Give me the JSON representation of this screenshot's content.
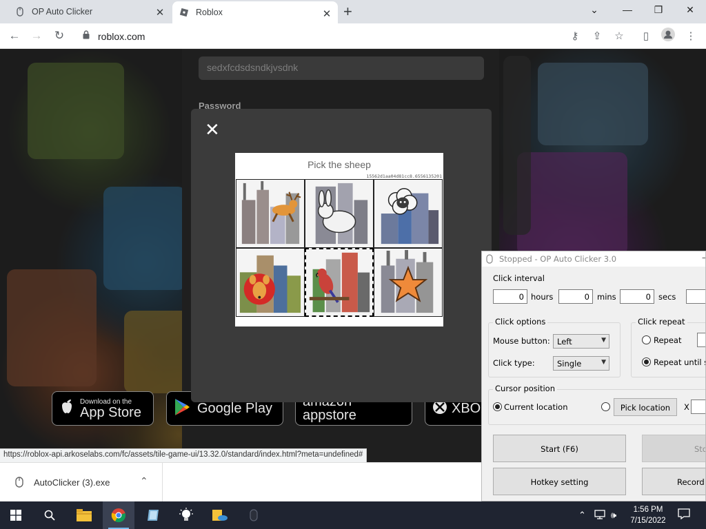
{
  "browser": {
    "tabs": [
      {
        "title": "OP Auto Clicker",
        "icon": "mouse-icon"
      },
      {
        "title": "Roblox",
        "icon": "roblox-icon"
      }
    ],
    "url": "roblox.com",
    "status_url": "https://roblox-api.arkoselabs.com/fc/assets/tile-game-ui/13.32.0/standard/index.html?meta=undefined#"
  },
  "page": {
    "username_value": "sedxfcdsdsndkjvsdnk",
    "password_label": "Password",
    "store_badges": [
      {
        "small": "Download on the",
        "big": "App Store"
      },
      {
        "small": "",
        "big": "Google Play"
      },
      {
        "small": "",
        "big": "amazon appstore"
      },
      {
        "small": "",
        "big": "XBOX"
      }
    ]
  },
  "captcha": {
    "prompt": "Pick the sheep",
    "hash": "15562d1aa04d81cc8.6556135201",
    "tiles": [
      "deer",
      "rabbit",
      "sheep",
      "kangaroo",
      "parrot",
      "starfish"
    ],
    "selected_index": 4
  },
  "downloads": {
    "filename": "AutoClicker (3).exe"
  },
  "taskbar": {
    "time": "1:56 PM",
    "date": "7/15/2022"
  },
  "autoclicker": {
    "title": "Stopped - OP Auto Clicker 3.0",
    "click_interval": {
      "label": "Click interval",
      "hours": "0",
      "hours_label": "hours",
      "mins": "0",
      "mins_label": "mins",
      "secs": "0",
      "secs_label": "secs"
    },
    "click_options": {
      "label": "Click options",
      "mouse_button_label": "Mouse button:",
      "mouse_button": "Left",
      "click_type_label": "Click type:",
      "click_type": "Single"
    },
    "click_repeat": {
      "label": "Click repeat",
      "repeat_label": "Repeat",
      "repeat_until_label": "Repeat until stop"
    },
    "cursor_position": {
      "label": "Cursor position",
      "current_label": "Current location",
      "pick_label": "Pick location",
      "x_label": "X"
    },
    "buttons": {
      "start": "Start (F6)",
      "stop": "Stop",
      "hotkey": "Hotkey setting",
      "record": "Record &"
    }
  }
}
